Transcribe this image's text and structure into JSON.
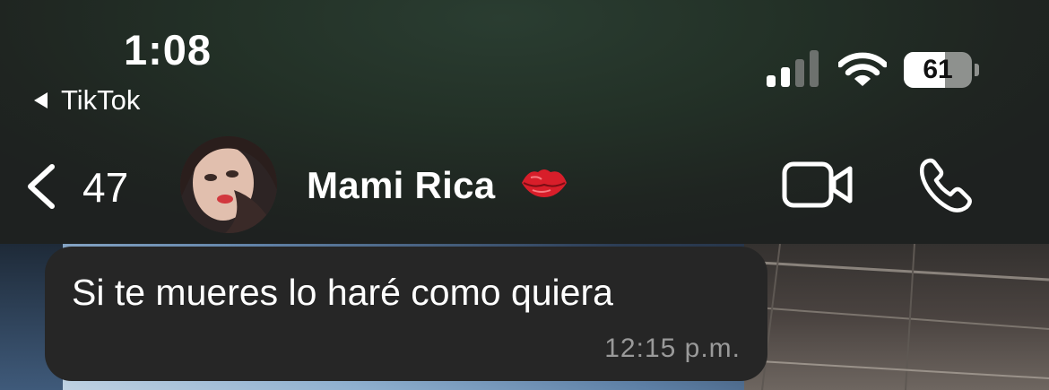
{
  "status_bar": {
    "time": "1:08",
    "back_app": "TikTok",
    "battery_level": "61",
    "battery_percent": 61
  },
  "header": {
    "back_count": "47",
    "contact_name": "Mami Rica",
    "name_emoji": "kiss-mark-icon"
  },
  "messages": [
    {
      "text": "Si te mueres lo haré como quiera",
      "time": "12:15 p.m.",
      "direction": "incoming"
    }
  ],
  "colors": {
    "header_bg": "#1f2521",
    "bubble_bg": "#262626",
    "time_text": "#9a9a9a",
    "battery_empty": "#8e918e"
  }
}
